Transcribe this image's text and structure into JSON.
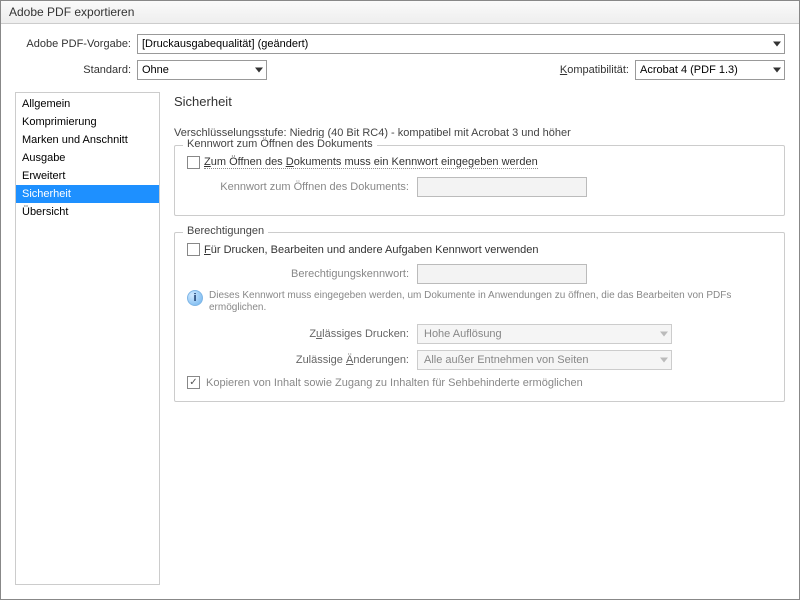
{
  "title": "Adobe PDF exportieren",
  "labels": {
    "preset": "Adobe PDF-Vorgabe:",
    "standard": "Standard:",
    "compat": "Kompatibilität:"
  },
  "values": {
    "preset": "[Druckausgabequalität] (geändert)",
    "standard": "Ohne",
    "compat": "Acrobat 4 (PDF 1.3)"
  },
  "sidebar": {
    "items": [
      {
        "label": "Allgemein"
      },
      {
        "label": "Komprimierung"
      },
      {
        "label": "Marken und Anschnitt"
      },
      {
        "label": "Ausgabe"
      },
      {
        "label": "Erweitert"
      },
      {
        "label": "Sicherheit"
      },
      {
        "label": "Übersicht"
      }
    ],
    "active_index": 5
  },
  "panel": {
    "heading": "Sicherheit",
    "encryption": "Verschlüsselungsstufe: Niedrig (40 Bit RC4) - kompatibel mit Acrobat 3 und höher",
    "group1": {
      "legend": "Kennwort zum Öffnen des Dokuments",
      "chk_label": "Zum Öffnen des Dokuments muss ein Kennwort eingegeben werden",
      "pwd_label": "Kennwort zum Öffnen des Dokuments:"
    },
    "group2": {
      "legend": "Berechtigungen",
      "chk_label": "Für Drucken, Bearbeiten und andere Aufgaben Kennwort verwenden",
      "pwd_label": "Berechtigungskennwort:",
      "info": "Dieses Kennwort muss eingegeben werden, um Dokumente in Anwendungen zu öffnen, die das Bearbeiten von PDFs ermöglichen.",
      "print_label": "Zulässiges Drucken:",
      "print_value": "Hohe Auflösung",
      "changes_label": "Zulässige Änderungen:",
      "changes_value": "Alle außer Entnehmen von Seiten",
      "copy_label": "Kopieren von Inhalt sowie Zugang zu Inhalten für Sehbehinderte ermöglichen"
    }
  }
}
